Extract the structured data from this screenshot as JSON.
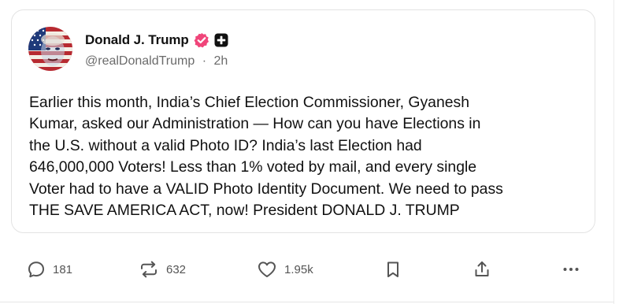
{
  "post": {
    "author": {
      "display_name": "Donald J. Trump",
      "handle": "@realDonaldTrump",
      "separator": "·",
      "timestamp": "2h",
      "verified_icon": "verified-check-icon",
      "badge_icon": "plus-badge-icon"
    },
    "text": "Earlier this month, India’s Chief Election Commissioner, Gyanesh\nKumar, asked our Administration — How can you have Elections in\nthe U.S. without a valid Photo ID? India’s last Election had\n646,000,000 Voters! Less than 1% voted by mail, and every single\nVoter had to have a VALID Photo Identity Document. We need to pass\nTHE SAVE AMERICA ACT, now! President DONALD J. TRUMP",
    "actions": {
      "replies": {
        "icon": "reply-icon",
        "count": "181"
      },
      "reposts": {
        "icon": "repost-icon",
        "count": "632"
      },
      "likes": {
        "icon": "heart-icon",
        "count": "1.95k"
      },
      "bookmark": {
        "icon": "bookmark-icon"
      },
      "share": {
        "icon": "share-icon"
      },
      "more": {
        "icon": "more-icon"
      }
    }
  },
  "colors": {
    "verified": "#f0457a",
    "text": "#111111",
    "muted": "#6b6b6b",
    "icon": "#555555",
    "border": "#e3e3e3"
  }
}
